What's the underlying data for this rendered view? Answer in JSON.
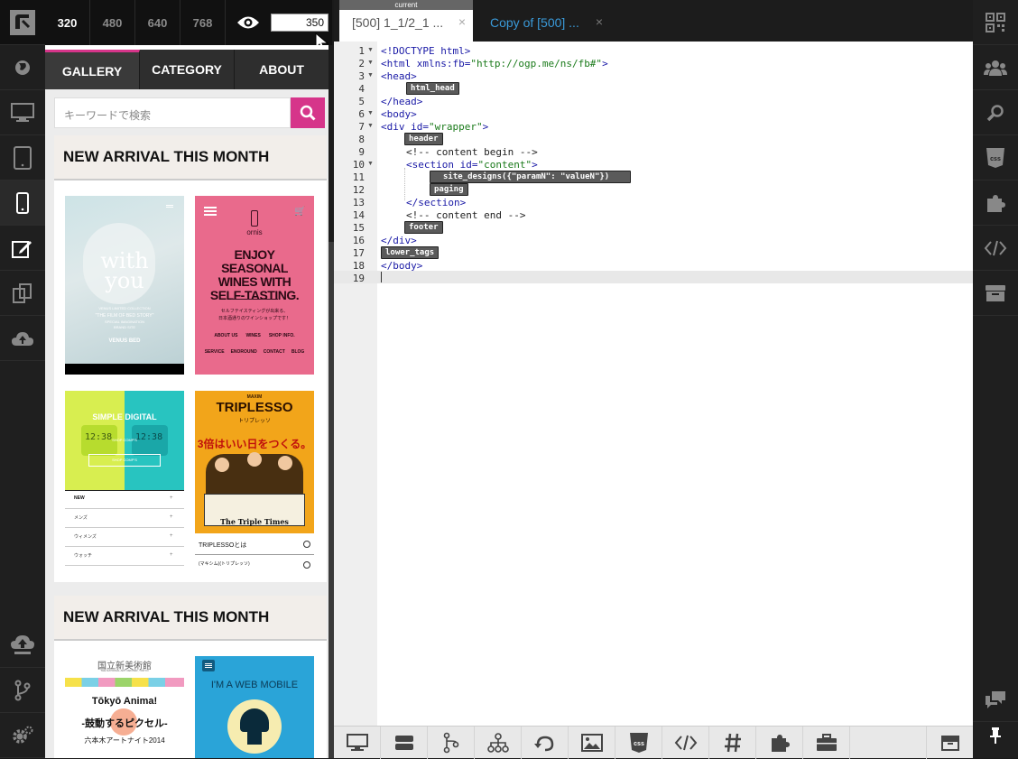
{
  "topbar": {
    "viewports": [
      "320",
      "480",
      "640",
      "768"
    ],
    "width_value": "350"
  },
  "preview": {
    "nav": [
      "GALLERY",
      "CATEGORY",
      "ABOUT"
    ],
    "search_placeholder": "キーワードで検索",
    "sections": [
      {
        "title": "NEW ARRIVAL THIS MONTH"
      },
      {
        "title": "NEW ARRIVAL THIS MONTH"
      }
    ],
    "thumbs": {
      "with_you": {
        "title_line1": "with",
        "title_line2": "you",
        "caption1": "VENUS LIMITED COLLECTION",
        "caption2": "\"THE FILM OF BED STORY\"",
        "caption3": "SPECIAL IMAGINATION",
        "caption4": "BRAND SITE",
        "brand": "VENUS BED"
      },
      "ornis": {
        "brand": "ornis",
        "headline": "ENJOY SEASONAL WINES WITH SELF-TASTING.",
        "sub1": "セルフテイスティングが出来る、",
        "sub2": "日本酒通りのワインショップです！",
        "links1": [
          "ABOUT US",
          "WINES",
          "SHOP INFO."
        ],
        "links2": [
          "SERVICE",
          "ENOROUND",
          "CONTACT",
          "BLOG"
        ]
      },
      "digital": {
        "title": "SIMPLE DIGITAL",
        "button1": "SHOP COMP'S",
        "button2": "SHOP COMP'S",
        "time1": "12:38",
        "time2": "12:38",
        "menu": [
          "NEW",
          "メンズ",
          "ウィメンズ",
          "ウォッチ"
        ]
      },
      "triplesso": {
        "maxim": "MAXIM",
        "title": "TRIPLESSO",
        "kana": "トリプレッソ",
        "tagline": "3倍はいい日をつくる。",
        "paper": "The Triple Times",
        "links": [
          "TRIPLESSOとは",
          "(マキシム)(トリプレッソ)"
        ]
      },
      "nact": {
        "logo": "国立新美術館",
        "logo_sub": "THE NATIONAL ART CENTER, TOKYO",
        "title": "Tōkyō Anima!",
        "sub": "-鼓動するピクセル-",
        "date": "六本木アートナイト2014"
      },
      "webmobile": {
        "title": "I'M A WEB MOBILE"
      }
    }
  },
  "editor": {
    "tabs": [
      {
        "label": "[500] 1_1/2_1 ...",
        "badge": "current",
        "close": "×"
      },
      {
        "label": "Copy of [500] ...",
        "close": "×"
      }
    ],
    "lines": [
      "1",
      "2",
      "3",
      "4",
      "5",
      "6",
      "7",
      "8",
      "9",
      "10",
      "11",
      "12",
      "13",
      "14",
      "15",
      "16",
      "17",
      "18",
      "19"
    ],
    "code": {
      "l1": "<!DOCTYPE html>",
      "l2_tag": "<html ",
      "l2_attr": "xmlns:fb=",
      "l2_val": "\"http://ogp.me/ns/fb#\"",
      "l2_end": ">",
      "l3": "<head>",
      "l5": "</head>",
      "l6": "<body>",
      "l7_tag": "<div ",
      "l7_attr": "id=",
      "l7_val": "\"wrapper\"",
      "l7_end": ">",
      "l9": "<!-- content begin -->",
      "l10_tag": "<section ",
      "l10_attr": "id=",
      "l10_val": "\"content\"",
      "l10_end": ">",
      "l13": "</section>",
      "l14": "<!-- content end -->",
      "l16": "</div>",
      "l18": "</body>"
    },
    "pills": {
      "html_head": "html_head",
      "header": "header",
      "site_designs": "site_designs({\"paramN\": \"valueN\"})",
      "paging": "paging",
      "footer": "footer",
      "lower_tags": "lower_tags"
    }
  },
  "colors": {
    "accent": "#d6358a",
    "code_tag": "#1a1aa6",
    "code_value": "#1a7a1a"
  }
}
